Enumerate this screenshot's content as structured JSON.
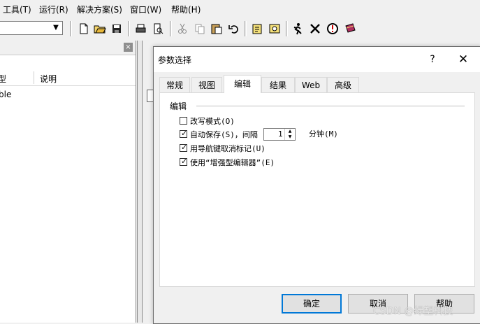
{
  "menubar": {
    "items": [
      "工具(T)",
      "运行(R)",
      "解决方案(S)",
      "窗口(W)",
      "帮助(H)"
    ]
  },
  "toolbar": {
    "icons": [
      "new-file-icon",
      "open-folder-icon",
      "save-icon",
      "print-icon",
      "print-preview-icon",
      "cut-icon",
      "copy-icon",
      "paste-icon",
      "undo-icon",
      "notes-icon",
      "find-icon",
      "run-icon",
      "stop-icon",
      "debug-icon",
      "book-icon"
    ]
  },
  "left_pane": {
    "col1": "型",
    "col2": "说明",
    "cell": "ble"
  },
  "dialog": {
    "title": "参数选择",
    "help": "?",
    "close": "✕",
    "tabs": [
      "常规",
      "视图",
      "编辑",
      "结果",
      "Web",
      "高级"
    ],
    "active_tab": "编辑",
    "group_title": "编辑",
    "options": [
      {
        "label": "改写模式(O)",
        "checked": false,
        "mark": ""
      },
      {
        "label": "自动保存(S)，间隔",
        "checked": true,
        "mark": "✓"
      },
      {
        "label": "用导航键取消标记(U)",
        "checked": true,
        "mark": "✓"
      },
      {
        "label": "使用“增强型编辑器”(E)",
        "checked": true,
        "mark": "✓"
      }
    ],
    "interval_value": "1",
    "interval_unit": "分钟(M)",
    "ok_label": "确定",
    "cancel_label": "取消",
    "help_label": "帮助"
  },
  "watermark": "CSDN @绿塑科技",
  "colors": {
    "accent": "#0078d7"
  }
}
